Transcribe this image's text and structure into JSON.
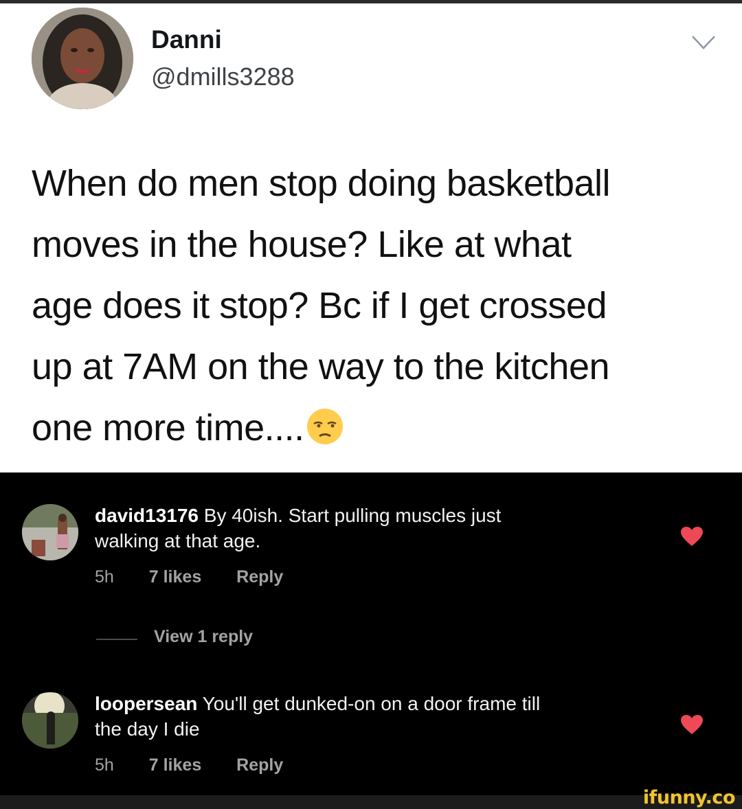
{
  "tweet": {
    "author_name": "Danni",
    "author_handle": "@dmills3288",
    "text_lines": [
      "When do men stop doing basketball",
      "moves in the house? Like at what",
      "age does it stop? Bc if I get crossed",
      "up at 7AM on the way to the kitchen",
      "one more time...."
    ],
    "emoji": "unamused-face-emoji",
    "menu_icon": "chevron-down-icon"
  },
  "comments": [
    {
      "username": "david13176",
      "text": "By 40ish. Start pulling muscles just walking at that age.",
      "line1": "By 40ish. Start pulling muscles just",
      "line2": "walking at that age.",
      "time": "5h",
      "likes": "7 likes",
      "reply": "Reply",
      "liked": true
    },
    {
      "username": "loopersean",
      "text": "You'll get dunked-on on a door frame till the day I die",
      "line1": "You'll get dunked-on on a door frame till",
      "line2": "the day I die",
      "time": "5h",
      "likes": "7 likes",
      "reply": "Reply",
      "liked": true
    }
  ],
  "view_replies_label": "View 1 reply",
  "watermark": "ifunny.co",
  "colors": {
    "heart": "#ed4956",
    "watermark": "#f0c330",
    "meta_text": "#a3a3a3"
  }
}
